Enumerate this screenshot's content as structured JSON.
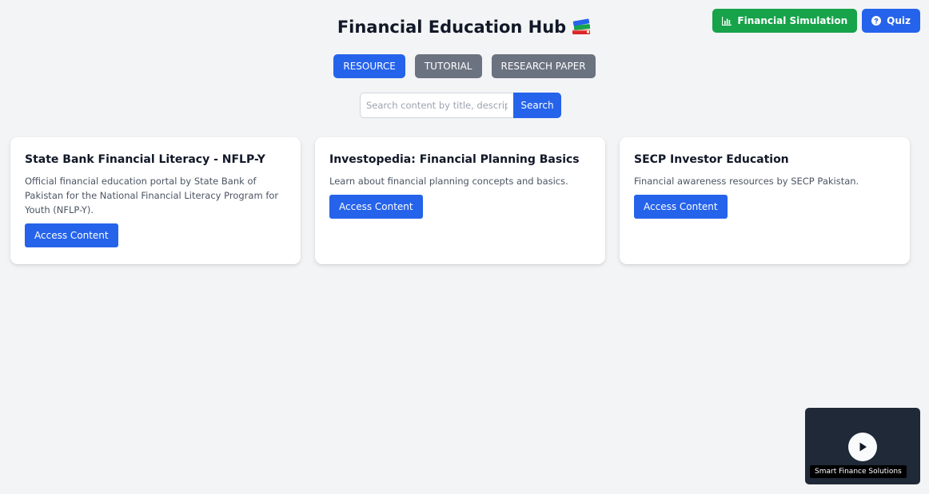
{
  "header": {
    "title": "Financial Education Hub",
    "title_icon": "books-icon",
    "simulation_button": "Financial Simulation",
    "simulation_icon": "bar-chart-icon",
    "quiz_button": "Quiz",
    "quiz_icon": "question-circle-icon"
  },
  "tabs": [
    {
      "label": "RESOURCE",
      "active": true
    },
    {
      "label": "TUTORIAL",
      "active": false
    },
    {
      "label": "RESEARCH PAPER",
      "active": false
    }
  ],
  "search": {
    "placeholder": "Search content by title, description...",
    "value": "",
    "button": "Search"
  },
  "cards": [
    {
      "title": "State Bank Financial Literacy - NFLP-Y",
      "description": "Official financial education portal by State Bank of Pakistan for the National Financial Literacy Program for Youth (NFLP-Y).",
      "button": "Access Content"
    },
    {
      "title": "Investopedia: Financial Planning Basics",
      "description": "Learn about financial planning concepts and basics.",
      "button": "Access Content"
    },
    {
      "title": "SECP Investor Education",
      "description": "Financial awareness resources by SECP Pakistan.",
      "button": "Access Content"
    }
  ],
  "video_widget": {
    "caption": "Smart Finance Solutions",
    "icon": "play-icon"
  },
  "colors": {
    "primary": "#2563eb",
    "success": "#16a34a",
    "inactive_tab": "#6b7280",
    "background": "#f3f4f6",
    "video_bg": "#1f2937"
  }
}
